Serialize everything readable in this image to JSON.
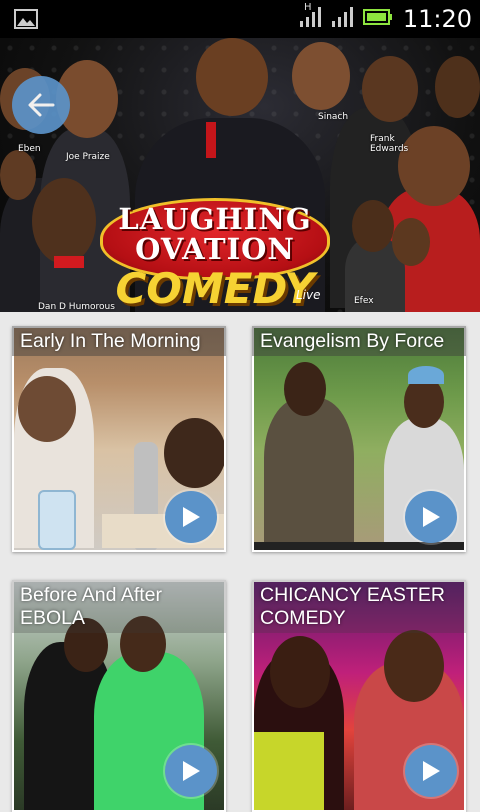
{
  "status_bar": {
    "time": "11:20",
    "network_type": "H"
  },
  "header": {
    "back_button_icon": "arrow-left-icon",
    "banner": {
      "line1": "LAUGHING",
      "line2": "OVATION",
      "line3": "COMEDY",
      "live": "Live",
      "names": [
        "Eben",
        "Joe Praize",
        "Sinach",
        "Frank Edwards",
        "Dan D Humorous",
        "Efex"
      ]
    }
  },
  "videos": [
    {
      "title": "Early In The Morning"
    },
    {
      "title": "Evangelism By Force"
    },
    {
      "title": "Before And After EBOLA"
    },
    {
      "title": "CHICANCY EASTER COMEDY"
    }
  ],
  "colors": {
    "accent": "#5b93c9",
    "statusbar": "#000000",
    "battery": "#8ee53f"
  }
}
